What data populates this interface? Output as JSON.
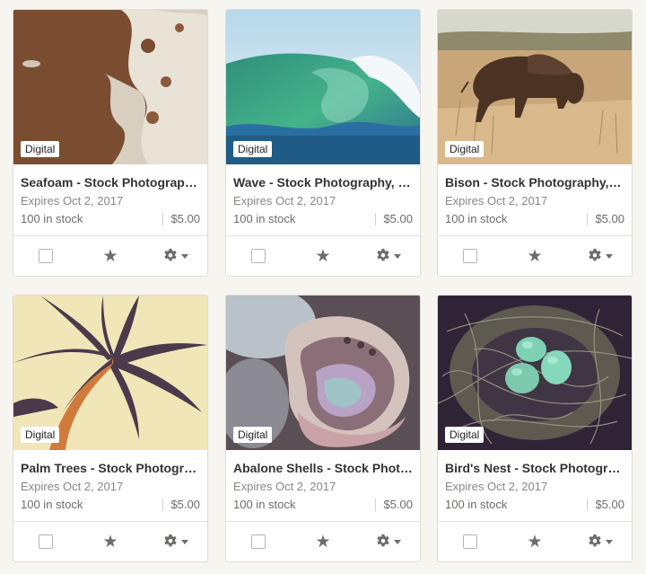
{
  "listings": [
    {
      "badge": "Digital",
      "title": "Seafoam - Stock Photography, Digital",
      "expires": "Expires Oct 2, 2017",
      "stock": "100 in stock",
      "price": "$5.00",
      "image": "seafoam"
    },
    {
      "badge": "Digital",
      "title": "Wave - Stock Photography, Digital",
      "expires": "Expires Oct 2, 2017",
      "stock": "100 in stock",
      "price": "$5.00",
      "image": "wave"
    },
    {
      "badge": "Digital",
      "title": "Bison - Stock Photography, Digital",
      "expires": "Expires Oct 2, 2017",
      "stock": "100 in stock",
      "price": "$5.00",
      "image": "bison"
    },
    {
      "badge": "Digital",
      "title": "Palm Trees - Stock Photography, Digital",
      "expires": "Expires Oct 2, 2017",
      "stock": "100 in stock",
      "price": "$5.00",
      "image": "palm-trees"
    },
    {
      "badge": "Digital",
      "title": "Abalone Shells - Stock Photography, Digital",
      "expires": "Expires Oct 2, 2017",
      "stock": "100 in stock",
      "price": "$5.00",
      "image": "abalone-shells"
    },
    {
      "badge": "Digital",
      "title": "Bird's Nest - Stock Photography, Digital",
      "expires": "Expires Oct 2, 2017",
      "stock": "100 in stock",
      "price": "$5.00",
      "image": "birds-nest"
    }
  ],
  "icons": {
    "select": "checkbox-icon",
    "feature": "star-icon",
    "settings": "gear-icon",
    "menu": "caret-down-icon"
  }
}
